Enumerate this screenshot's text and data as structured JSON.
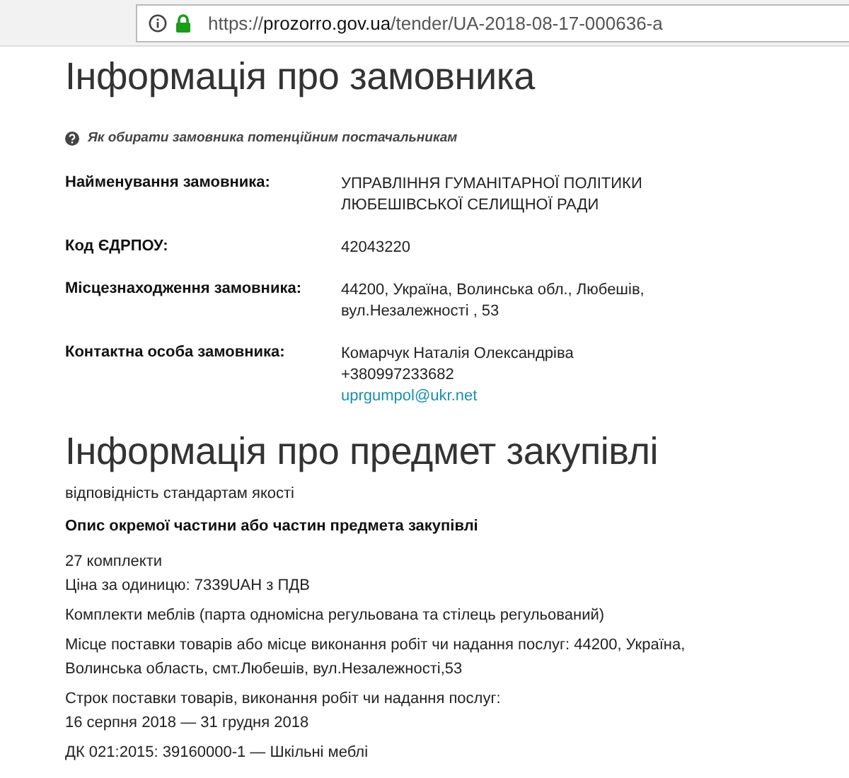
{
  "browser": {
    "url_prefix": "https://",
    "url_host": "prozorro.gov.ua",
    "url_path": "/tender/UA-2018-08-17-000636-a",
    "secure": true
  },
  "customer": {
    "title": "Інформація про замовника",
    "help": "Як обирати замовника потенційним постачальникам",
    "rows": [
      {
        "label": "Найменування замовника:",
        "values": [
          {
            "kind": "text",
            "text": "УПРАВЛІННЯ ГУМАНІТАРНОЇ ПОЛІТИКИ"
          },
          {
            "kind": "text",
            "text": "ЛЮБЕШІВСЬКОЇ СЕЛИЩНОЇ РАДИ"
          }
        ]
      },
      {
        "label": "Код ЄДРПОУ:",
        "values": [
          {
            "kind": "text",
            "text": "42043220"
          }
        ]
      },
      {
        "label": "Місцезнаходження замовника:",
        "values": [
          {
            "kind": "text",
            "text": "44200, Україна, Волинська обл., Любешів,"
          },
          {
            "kind": "text",
            "text": "вул.Незалежності , 53"
          }
        ]
      },
      {
        "label": "Контактна особа замовника:",
        "values": [
          {
            "kind": "text",
            "text": "Комарчук Наталія Олександріва"
          },
          {
            "kind": "text",
            "text": "+380997233682"
          },
          {
            "kind": "link",
            "text": "uprgumpol@ukr.net"
          }
        ]
      }
    ]
  },
  "subject": {
    "title": "Інформація про предмет закупівлі",
    "items": [
      {
        "kind": "text",
        "lines": [
          "відповідність стандартам якості"
        ]
      },
      {
        "kind": "heading",
        "lines": [
          "Опис окремої частини або частин предмета закупівлі"
        ]
      },
      {
        "kind": "text",
        "lines": [
          "27 комплекти",
          "Ціна за одиницю: 7339UAH з ПДВ"
        ]
      },
      {
        "kind": "text",
        "lines": [
          "Комплекти меблів (парта одномісна регульована та стілець регульований)"
        ]
      },
      {
        "kind": "text",
        "lines": [
          "Місце поставки товарів або місце виконання робіт чи надання послуг: 44200, Україна,",
          "Волинська область, смт.Любешів, вул.Незалежності,53"
        ]
      },
      {
        "kind": "text",
        "lines": [
          "Строк поставки товарів, виконання робіт чи надання послуг:",
          "16 серпня 2018  —  31 грудня 2018"
        ]
      },
      {
        "kind": "text",
        "lines": [
          "ДК 021:2015: 39160000-1 — Шкільні меблі"
        ]
      }
    ]
  }
}
